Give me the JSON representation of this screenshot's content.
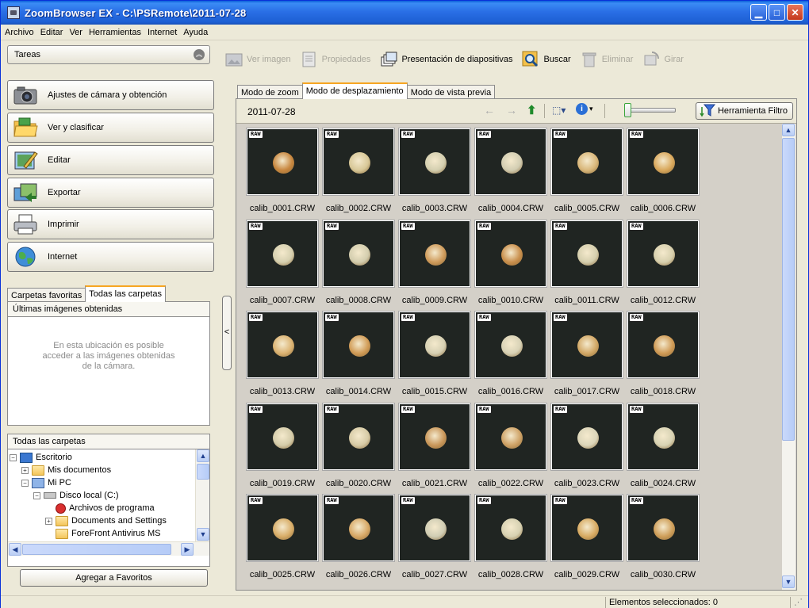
{
  "window": {
    "title": "ZoomBrowser EX  -  C:\\PSRemote\\2011-07-28"
  },
  "menu": [
    "Archivo",
    "Editar",
    "Ver",
    "Herramientas",
    "Internet",
    "Ayuda"
  ],
  "tasks": {
    "header": "Tareas",
    "buttons": [
      {
        "label": "Ajustes de cámara y obtención",
        "icon": "camera-icon"
      },
      {
        "label": "Ver y clasificar",
        "icon": "folder-icon"
      },
      {
        "label": "Editar",
        "icon": "edit-icon"
      },
      {
        "label": "Exportar",
        "icon": "export-icon"
      },
      {
        "label": "Imprimir",
        "icon": "printer-icon"
      },
      {
        "label": "Internet",
        "icon": "globe-icon"
      }
    ]
  },
  "left_tabs": [
    "Carpetas favoritas",
    "Todas las carpetas"
  ],
  "recent": {
    "title": "Últimas imágenes obtenidas",
    "message_line1": "En esta ubicación es posible",
    "message_line2": "acceder a las imágenes obtenidas",
    "message_line3": "de la cámara."
  },
  "folders": {
    "title": "Todas las carpetas",
    "items": [
      {
        "label": "Escritorio",
        "toggle": "−"
      },
      {
        "label": "Mis documentos",
        "toggle": "+"
      },
      {
        "label": "Mi PC",
        "toggle": "−"
      },
      {
        "label": "Disco local (C:)",
        "toggle": "−"
      },
      {
        "label": "Archivos de programa",
        "toggle": ""
      },
      {
        "label": "Documents and Settings",
        "toggle": "+"
      },
      {
        "label": "ForeFront Antivirus MS",
        "toggle": ""
      }
    ],
    "add_favorites": "Agregar a Favoritos"
  },
  "toolbar": {
    "view_image": "Ver imagen",
    "properties": "Propiedades",
    "slideshow": "Presentación de diapositivas",
    "search": "Buscar",
    "delete": "Eliminar",
    "rotate": "Girar"
  },
  "view_tabs": [
    "Modo de zoom",
    "Modo de desplazamiento",
    "Modo de vista previa"
  ],
  "address": {
    "folder": "2011-07-28",
    "filter_button": "Herramienta Filtro"
  },
  "badge": "RAW",
  "images": [
    {
      "name": "calib_0001.CRW",
      "color": "#c8873f"
    },
    {
      "name": "calib_0002.CRW",
      "color": "#d8c898"
    },
    {
      "name": "calib_0003.CRW",
      "color": "#d4cfb0"
    },
    {
      "name": "calib_0004.CRW",
      "color": "#d2cdb2"
    },
    {
      "name": "calib_0005.CRW",
      "color": "#d9b77a"
    },
    {
      "name": "calib_0006.CRW",
      "color": "#d9a85c"
    },
    {
      "name": "calib_0007.CRW",
      "color": "#d6d0b0"
    },
    {
      "name": "calib_0008.CRW",
      "color": "#d3cdae"
    },
    {
      "name": "calib_0009.CRW",
      "color": "#cf9b5b"
    },
    {
      "name": "calib_0010.CRW",
      "color": "#c98f4c"
    },
    {
      "name": "calib_0011.CRW",
      "color": "#d5cfae"
    },
    {
      "name": "calib_0012.CRW",
      "color": "#d7d0ae"
    },
    {
      "name": "calib_0013.CRW",
      "color": "#dbb372"
    },
    {
      "name": "calib_0014.CRW",
      "color": "#d19c57"
    },
    {
      "name": "calib_0015.CRW",
      "color": "#d6d0b3"
    },
    {
      "name": "calib_0016.CRW",
      "color": "#d8d2b6"
    },
    {
      "name": "calib_0017.CRW",
      "color": "#d2a866"
    },
    {
      "name": "calib_0018.CRW",
      "color": "#cf9a55"
    },
    {
      "name": "calib_0019.CRW",
      "color": "#d4ccaa"
    },
    {
      "name": "calib_0020.CRW",
      "color": "#d7cba6"
    },
    {
      "name": "calib_0021.CRW",
      "color": "#c9975a"
    },
    {
      "name": "calib_0022.CRW",
      "color": "#cea266"
    },
    {
      "name": "calib_0023.CRW",
      "color": "#dcd6ba"
    },
    {
      "name": "calib_0024.CRW",
      "color": "#d8d3b4"
    },
    {
      "name": "calib_0025.CRW",
      "color": "#d8ad68"
    },
    {
      "name": "calib_0026.CRW",
      "color": "#d7a866"
    },
    {
      "name": "calib_0027.CRW",
      "color": "#d0cdb4"
    },
    {
      "name": "calib_0028.CRW",
      "color": "#d7d1b2"
    },
    {
      "name": "calib_0029.CRW",
      "color": "#d8ab63"
    },
    {
      "name": "calib_0030.CRW",
      "color": "#cf9f5a"
    }
  ],
  "status": {
    "selected": "Elementos seleccionados: 0"
  }
}
